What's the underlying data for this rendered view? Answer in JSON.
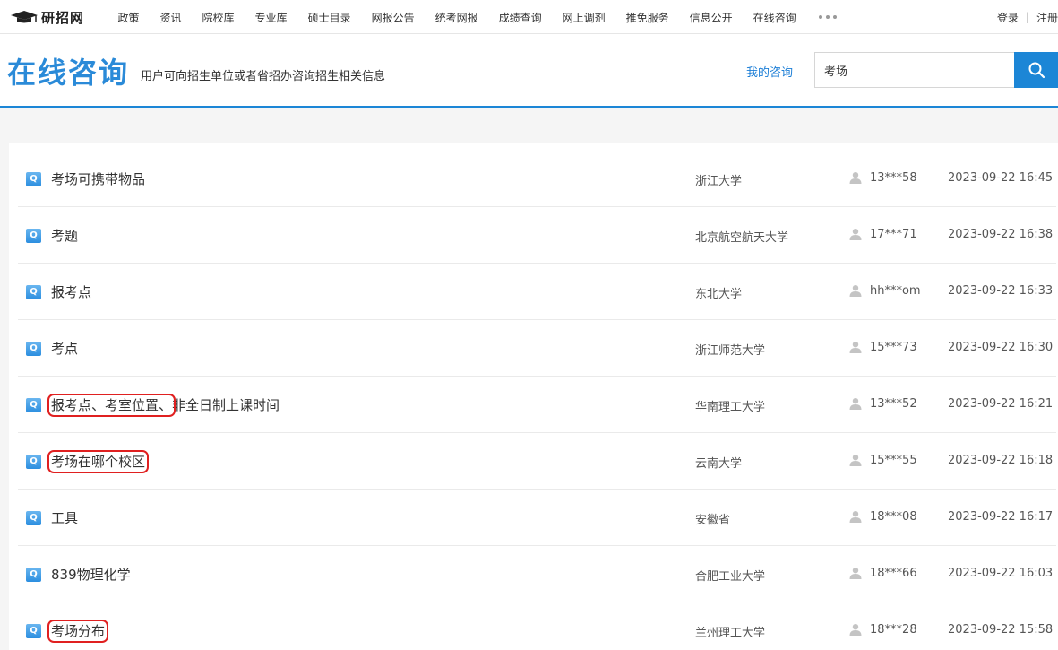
{
  "topnav": {
    "logo_text": "研招网",
    "items": [
      "政策",
      "资讯",
      "院校库",
      "专业库",
      "硕士目录",
      "网报公告",
      "统考网报",
      "成绩查询",
      "网上调剂",
      "推免服务",
      "信息公开",
      "在线咨询"
    ],
    "more_icon": "ellipsis-icon",
    "login_label": "登录",
    "separator": "|",
    "register_label": "注册"
  },
  "header": {
    "title": "在线咨询",
    "subtitle": "用户可向招生单位或者省招办咨询招生相关信息",
    "my_consult_label": "我的咨询",
    "search_value": "考场",
    "search_icon": "search-icon",
    "accent_color": "#1c86d6"
  },
  "questions": [
    {
      "title_parts": [
        "考场可携带物品"
      ],
      "highlight": [
        false
      ],
      "school": "浙江大学",
      "user": "13***58",
      "time": "2023-09-22 16:45"
    },
    {
      "title_parts": [
        "考题"
      ],
      "highlight": [
        false
      ],
      "school": "北京航空航天大学",
      "user": "17***71",
      "time": "2023-09-22 16:38"
    },
    {
      "title_parts": [
        "报考点"
      ],
      "highlight": [
        false
      ],
      "school": "东北大学",
      "user": "hh***om",
      "time": "2023-09-22 16:33"
    },
    {
      "title_parts": [
        "考点"
      ],
      "highlight": [
        false
      ],
      "school": "浙江师范大学",
      "user": "15***73",
      "time": "2023-09-22 16:30"
    },
    {
      "title_parts": [
        "报考点、考室位置、",
        "非全日制上课时间"
      ],
      "highlight": [
        true,
        false
      ],
      "school": "华南理工大学",
      "user": "13***52",
      "time": "2023-09-22 16:21"
    },
    {
      "title_parts": [
        "考场在哪个校区"
      ],
      "highlight": [
        true
      ],
      "school": "云南大学",
      "user": "15***55",
      "time": "2023-09-22 16:18"
    },
    {
      "title_parts": [
        "工具"
      ],
      "highlight": [
        false
      ],
      "school": "安徽省",
      "user": "18***08",
      "time": "2023-09-22 16:17"
    },
    {
      "title_parts": [
        "839物理化学"
      ],
      "highlight": [
        false
      ],
      "school": "合肥工业大学",
      "user": "18***66",
      "time": "2023-09-22 16:03"
    },
    {
      "title_parts": [
        "考场分布"
      ],
      "highlight": [
        true
      ],
      "school": "兰州理工大学",
      "user": "18***28",
      "time": "2023-09-22 15:58"
    }
  ],
  "q_badge": "Q"
}
